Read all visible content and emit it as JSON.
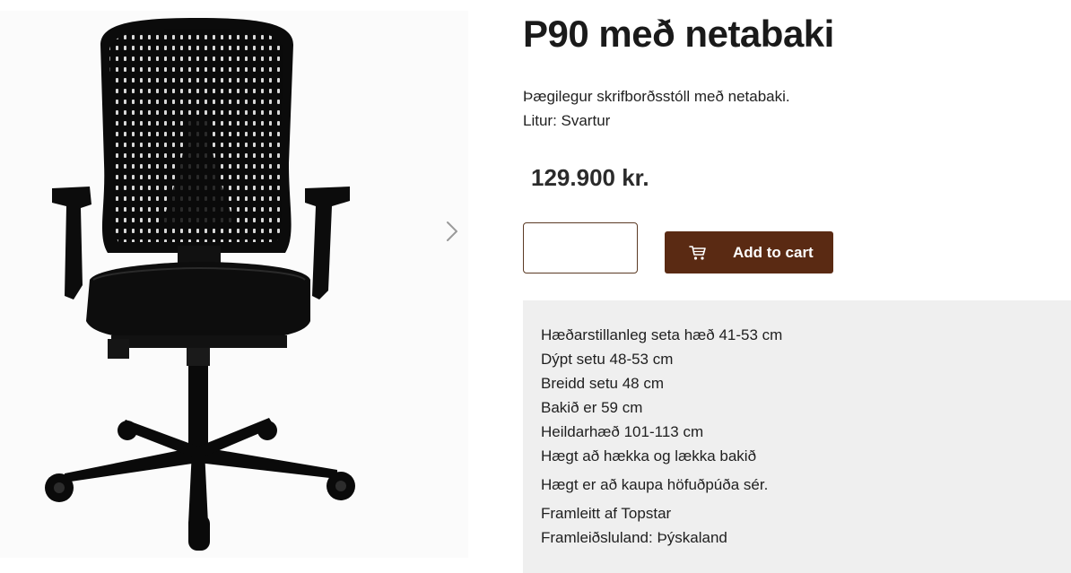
{
  "gallery": {
    "image_alt": "Black office chair with mesh back"
  },
  "product": {
    "title": "P90 með netabaki",
    "description": "Þægilegur skrifborðsstóll með netabaki.",
    "color_line": "Litur: Svartur",
    "price": "129.900 kr."
  },
  "cart": {
    "quantity_value": "",
    "add_to_cart_label": "Add to cart",
    "button_color": "#5a2a13"
  },
  "specs": {
    "lines": [
      "Hæðarstillanleg seta hæð 41-53 cm",
      "Dýpt setu 48-53 cm",
      "Breidd setu 48 cm",
      "Bakið er 59 cm",
      "Heildarhæð 101-113 cm",
      "Hægt að hækka og lækka bakið",
      "Hægt er að kaupa höfuðpúða sér.",
      "Framleitt af Topstar",
      "Framleiðsluland: Þýskaland"
    ]
  },
  "icons": {
    "next": "chevron-right-icon",
    "cart": "cart-icon"
  }
}
